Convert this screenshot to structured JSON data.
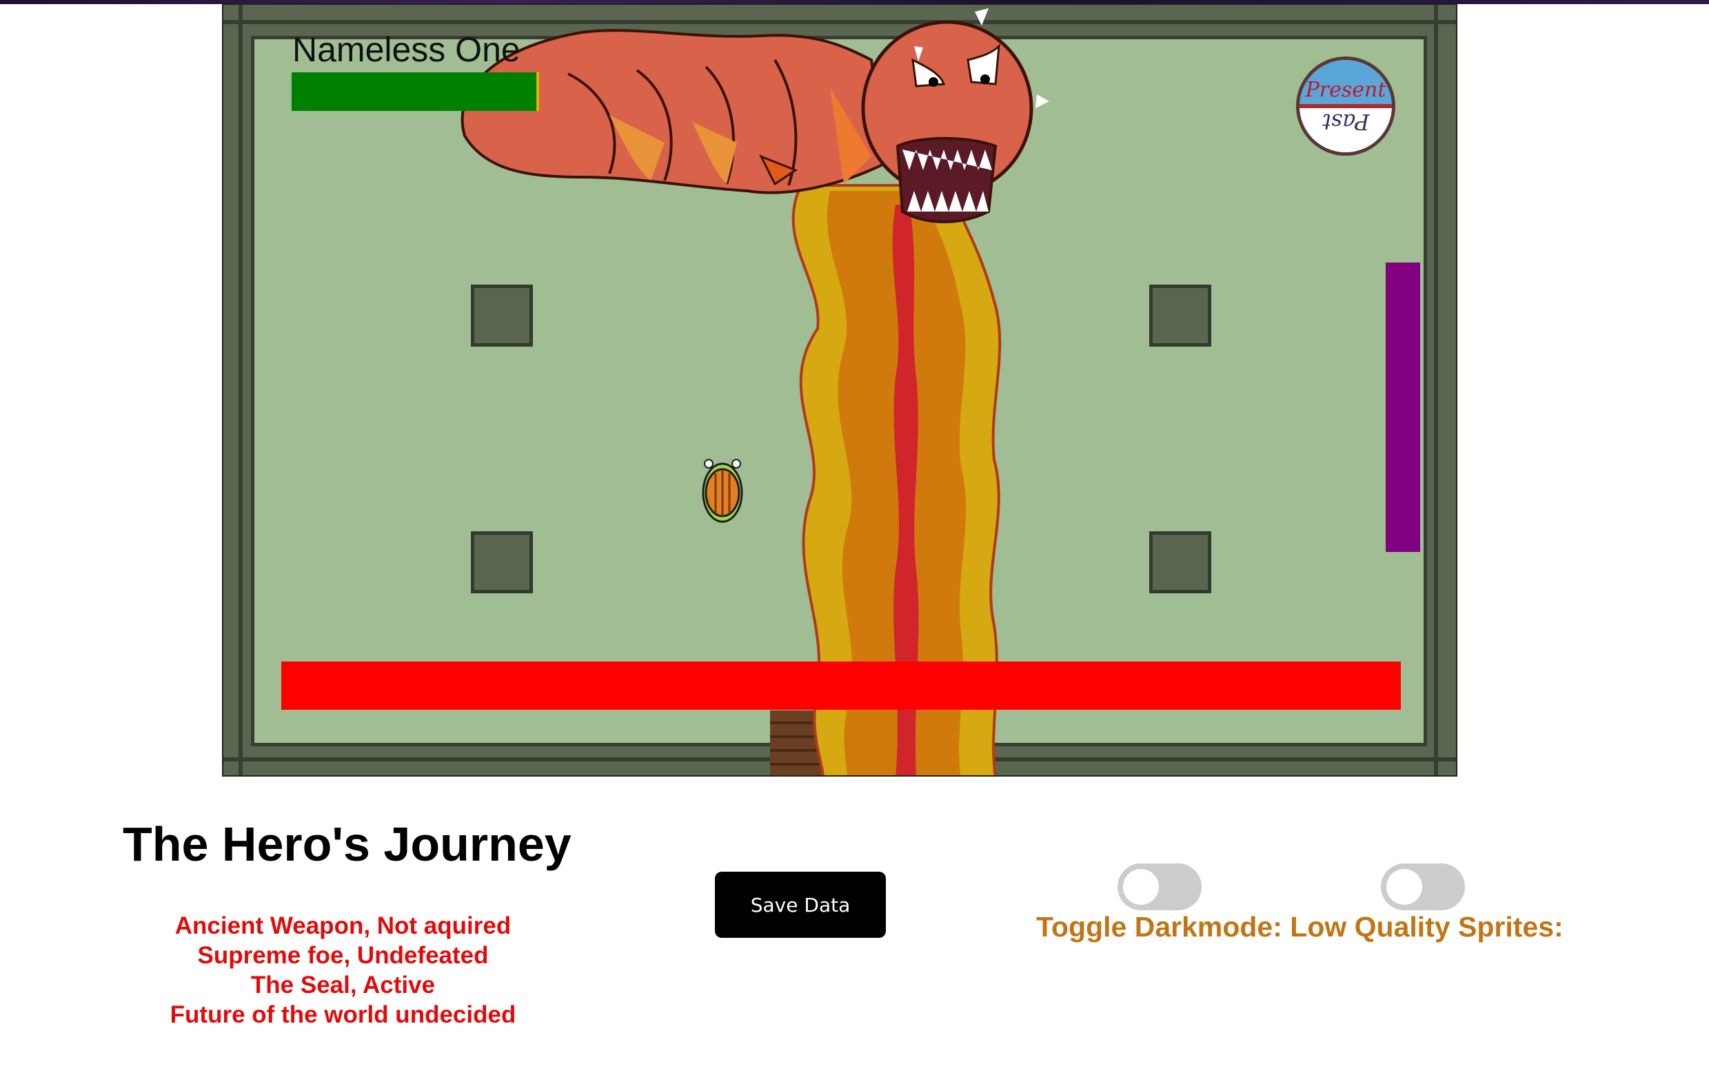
{
  "game": {
    "boss": {
      "name": "Nameless One",
      "hp_fraction": 0.99,
      "sprite": "dragon-sprite"
    },
    "player": {
      "hp_fraction": 1.0,
      "sprite": "turtle-hero-sprite"
    },
    "time_badge": {
      "top_label": "Present",
      "bottom_label": "Past"
    },
    "colors": {
      "floor": "#a0bd93",
      "wall": "#5b6651",
      "boss_hp": "#008000",
      "player_hp": "#ff0000",
      "side_bar": "#800080"
    }
  },
  "page": {
    "title": "The Hero's Journey",
    "status_lines": [
      "Ancient Weapon, Not aquired",
      "Supreme foe, Undefeated",
      "The Seal, Active",
      "Future of the world undecided"
    ],
    "save_button": "Save Data",
    "toggles": {
      "darkmode_on": false,
      "low_quality_on": false
    },
    "toggle_labels": "Toggle Darkmode: Low Quality Sprites:"
  }
}
